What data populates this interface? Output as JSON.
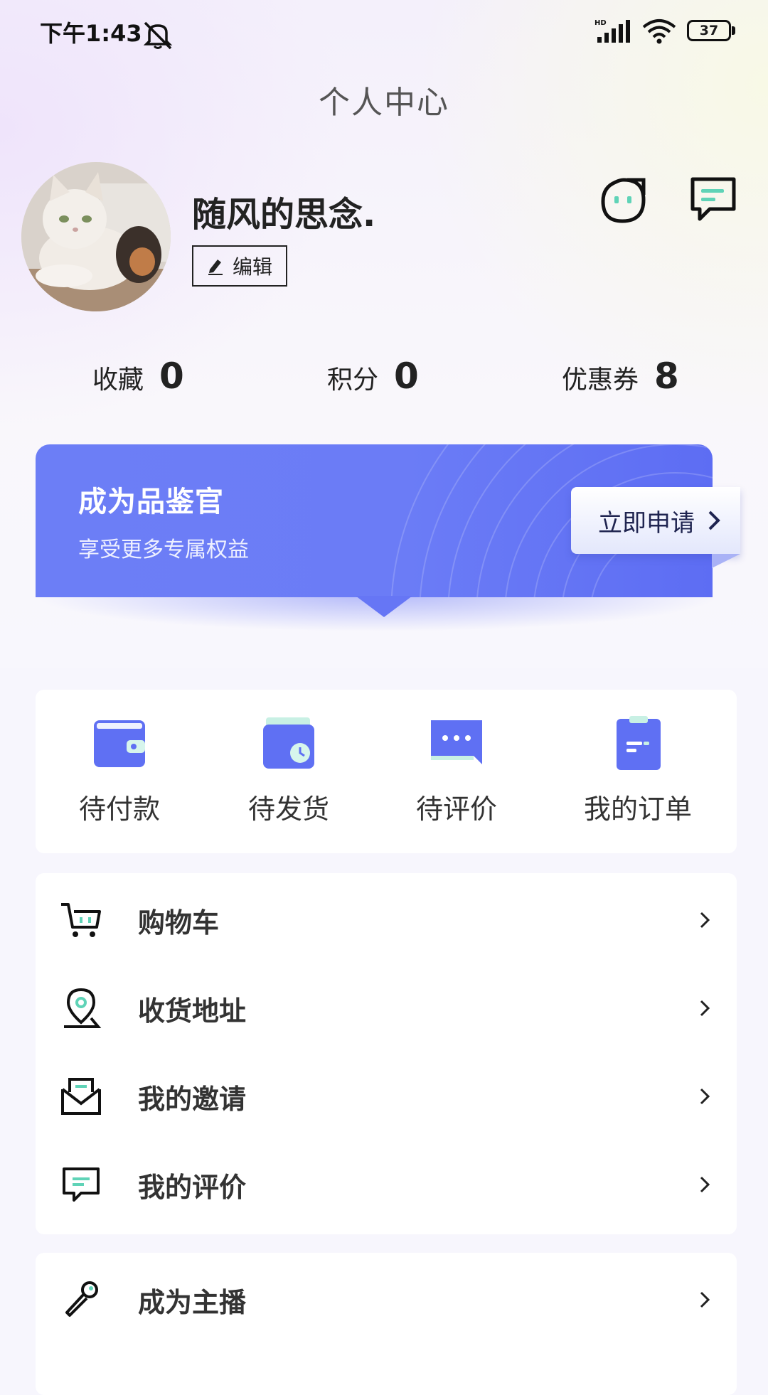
{
  "status_bar": {
    "time": "下午1:43",
    "battery": "37",
    "network_badge": "HD"
  },
  "page": {
    "title": "个人中心"
  },
  "profile": {
    "username": "随风的思念.",
    "edit_label": "编辑"
  },
  "stats": [
    {
      "label": "收藏",
      "value": "0"
    },
    {
      "label": "积分",
      "value": "0"
    },
    {
      "label": "优惠券",
      "value": "8"
    }
  ],
  "banner": {
    "title": "成为品鉴官",
    "subtitle": "享受更多专属权益",
    "button_label": "立即申请"
  },
  "orders": [
    {
      "label": "待付款",
      "icon": "wallet-icon"
    },
    {
      "label": "待发货",
      "icon": "wallet-clock-icon"
    },
    {
      "label": "待评价",
      "icon": "comment-bubble-icon"
    },
    {
      "label": "我的订单",
      "icon": "clipboard-icon"
    }
  ],
  "menu": [
    {
      "label": "购物车",
      "icon": "cart-icon"
    },
    {
      "label": "收货地址",
      "icon": "location-pin-icon"
    },
    {
      "label": "我的邀请",
      "icon": "envelope-icon"
    },
    {
      "label": "我的评价",
      "icon": "review-icon"
    },
    {
      "label": "成为主播",
      "icon": "microphone-icon"
    }
  ],
  "colors": {
    "accent": "#6b7cf6",
    "accent_light": "#5fd3b7",
    "text_dark": "#222222"
  }
}
